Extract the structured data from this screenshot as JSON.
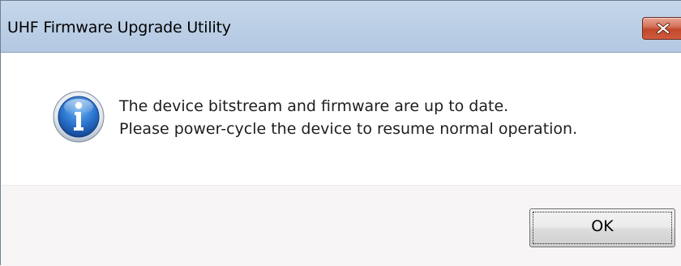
{
  "window": {
    "title": "UHF Firmware Upgrade Utility"
  },
  "titlebar": {
    "close_icon": "close-x-icon",
    "close_color": "#c7452a"
  },
  "message": {
    "icon": "information-icon",
    "line1": "The device bitstream and firmware are up to date.",
    "line2": "Please power-cycle the device to resume normal operation."
  },
  "buttons": {
    "ok_label": "OK"
  }
}
